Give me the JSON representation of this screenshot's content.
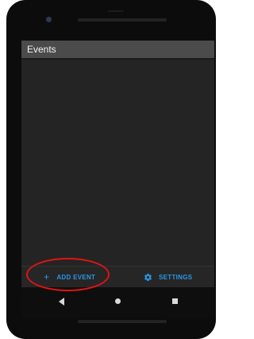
{
  "app_bar": {
    "title": "Events"
  },
  "bottom_bar": {
    "add_event": {
      "icon": "plus-icon",
      "label": "ADD EVENT"
    },
    "settings": {
      "icon": "gear-icon",
      "label": "SETTINGS"
    }
  },
  "nav_bar": {
    "back": {
      "icon": "back-triangle-icon"
    },
    "home": {
      "icon": "home-circle-icon"
    },
    "recents": {
      "icon": "recents-square-icon"
    }
  },
  "colors": {
    "accent": "#2a97e6",
    "app_bar": "#4b4b4b",
    "background": "#242424",
    "annotation": "#e01414"
  }
}
